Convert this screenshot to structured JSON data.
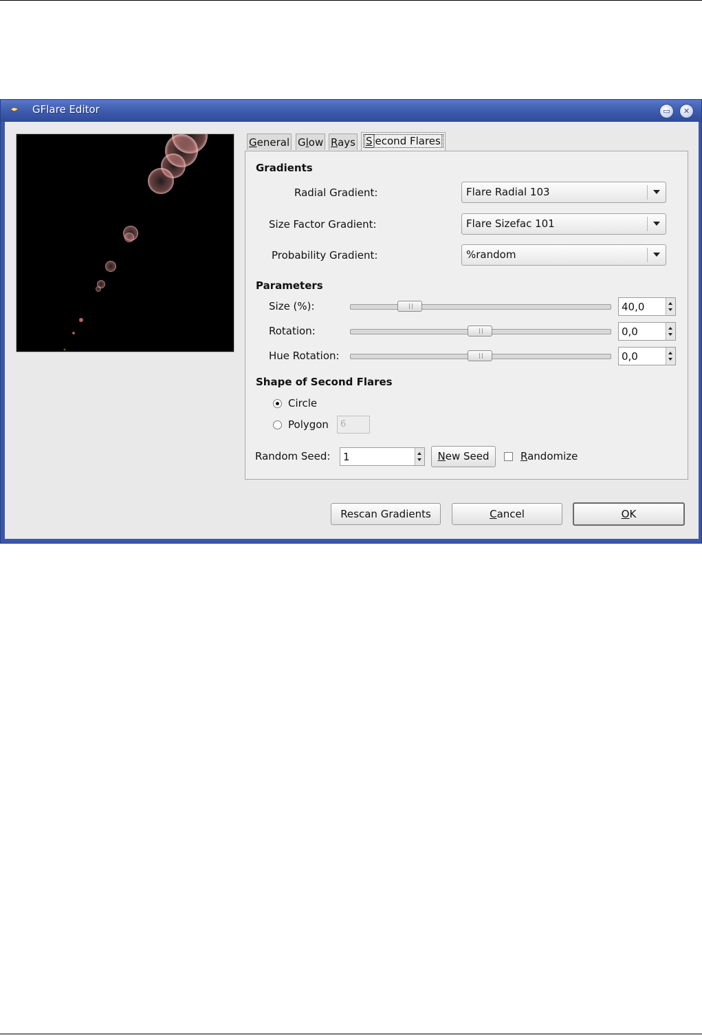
{
  "window": {
    "title": "GFlare Editor"
  },
  "tabs": [
    {
      "label": "General",
      "mnemonic": "G",
      "rest": "eneral"
    },
    {
      "label": "Glow",
      "pre": "G",
      "mnemonic": "l",
      "rest": "ow"
    },
    {
      "label": "Rays",
      "mnemonic": "R",
      "rest": "ays"
    },
    {
      "label": "Second Flares",
      "mnemonic": "S",
      "rest": "econd Flares"
    }
  ],
  "gradients": {
    "heading": "Gradients",
    "radial_label": "Radial Gradient:",
    "radial_value": "Flare Radial 103",
    "sizefac_label": "Size Factor Gradient:",
    "sizefac_value": "Flare Sizefac 101",
    "prob_label": "Probability Gradient:",
    "prob_value": "%random"
  },
  "parameters": {
    "heading": "Parameters",
    "size_label": "Size (%):",
    "size_value": "40,0",
    "rotation_label": "Rotation:",
    "rotation_value": "0,0",
    "hue_label": "Hue Rotation:",
    "hue_value": "0,0"
  },
  "shape": {
    "heading": "Shape of Second Flares",
    "circle_label": "Circle",
    "polygon_label": "Polygon",
    "polygon_value": "6",
    "selected": "Circle"
  },
  "seed": {
    "label": "Random Seed:",
    "value": "1",
    "new_seed": {
      "mnemonic": "N",
      "rest": "ew Seed"
    },
    "randomize": {
      "mnemonic": "R",
      "rest": "andomize"
    }
  },
  "buttons": {
    "rescan": "Rescan Gradients",
    "cancel": {
      "mnemonic": "C",
      "rest": "ancel"
    },
    "ok": {
      "mnemonic": "O",
      "rest": "K"
    }
  },
  "colors": {
    "titlebar": "#3d5aac",
    "flare": "#e89a9a"
  }
}
